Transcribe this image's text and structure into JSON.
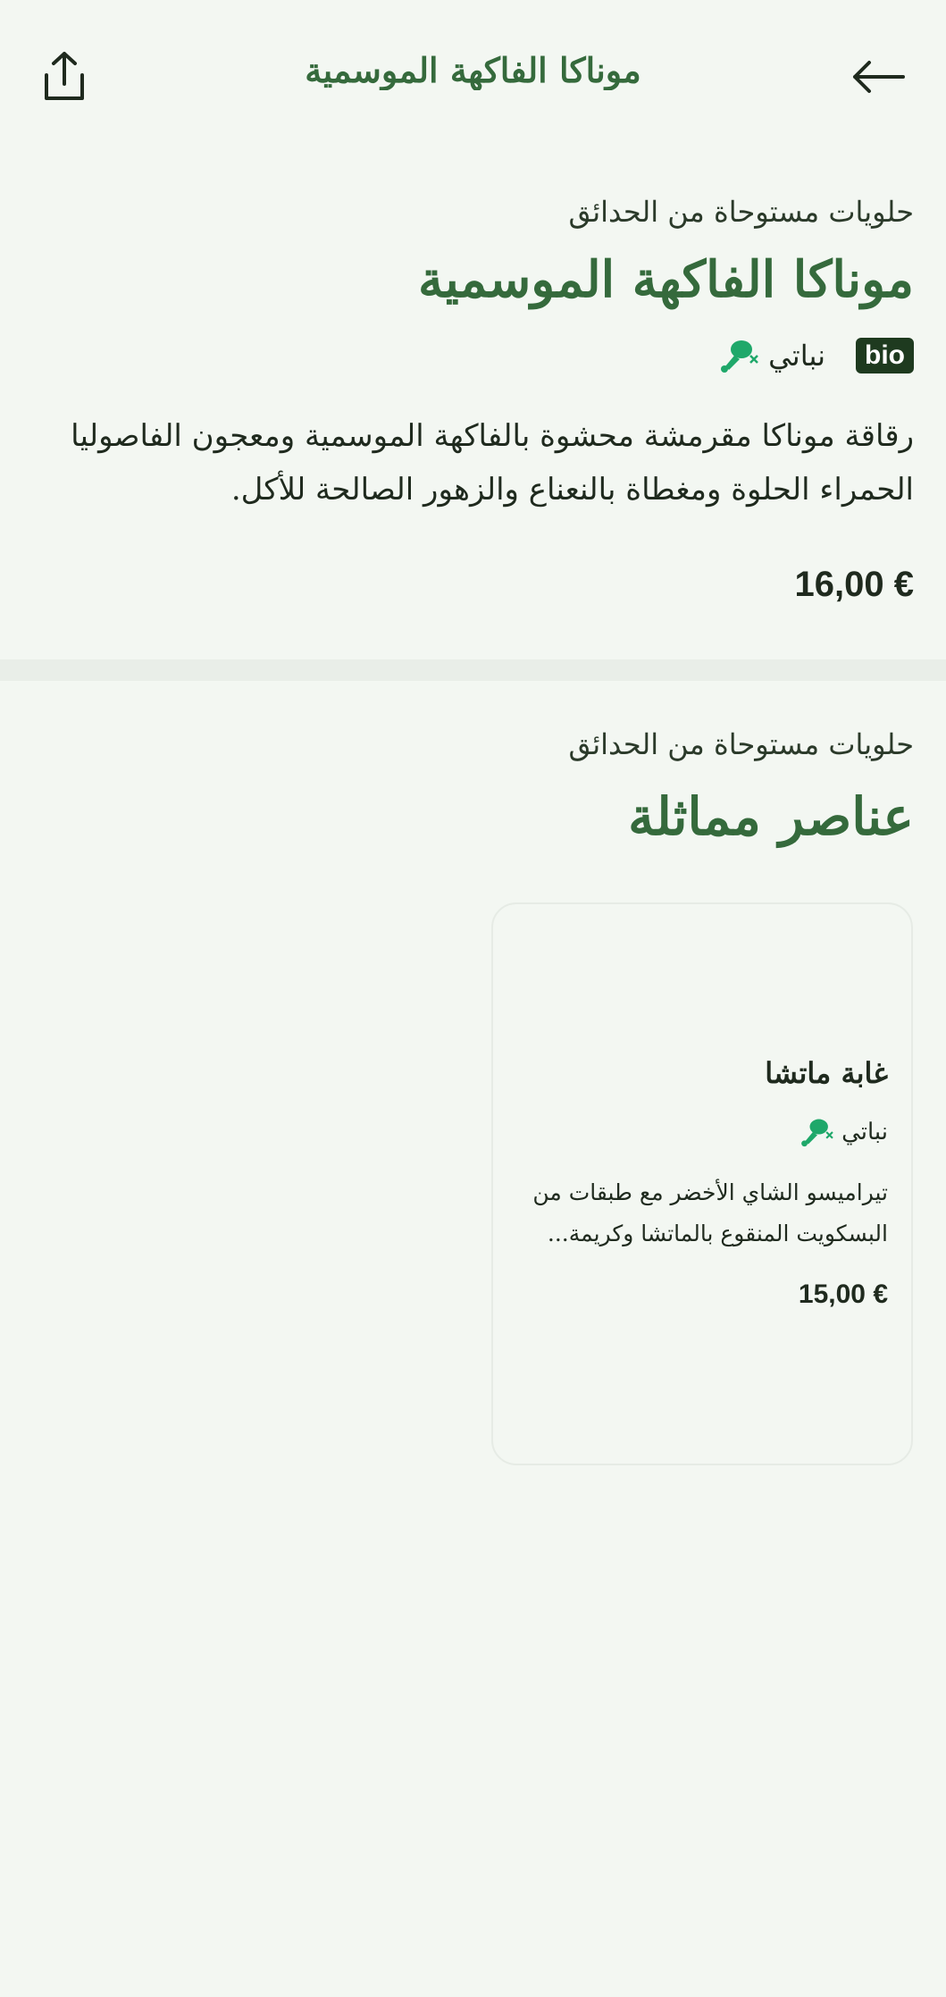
{
  "header": {
    "title": "موناكا الفاكهة الموسمية",
    "share_icon": "share-icon",
    "back_icon": "arrow-left-icon"
  },
  "product": {
    "category": "حلويات مستوحاة من الحدائق",
    "title": "موناكا الفاكهة الموسمية",
    "badge": "bio",
    "diet_label": "نباتي",
    "diet_icon": "vegan-drumstick-icon",
    "description": "رقاقة موناكا مقرمشة محشوة بالفاكهة الموسمية ومعجون الفاصوليا الحمراء الحلوة ومغطاة بالنعناع والزهور الصالحة للأكل.",
    "price": "16,00 €"
  },
  "similar": {
    "category": "حلويات مستوحاة من الحدائق",
    "title": "عناصر مماثلة",
    "items": [
      {
        "name": "غابة ماتشا",
        "diet_label": "نباتي",
        "description": "تيراميسو الشاي الأخضر مع طبقات من البسكويت المنقوع بالماتشا وكريمة...",
        "price": "15,00 €"
      }
    ]
  },
  "colors": {
    "background": "#f3f7f2",
    "accent_green": "#356a3c",
    "badge_dark": "#1e3a1f",
    "vegan_icon_green": "#1fa86a"
  }
}
